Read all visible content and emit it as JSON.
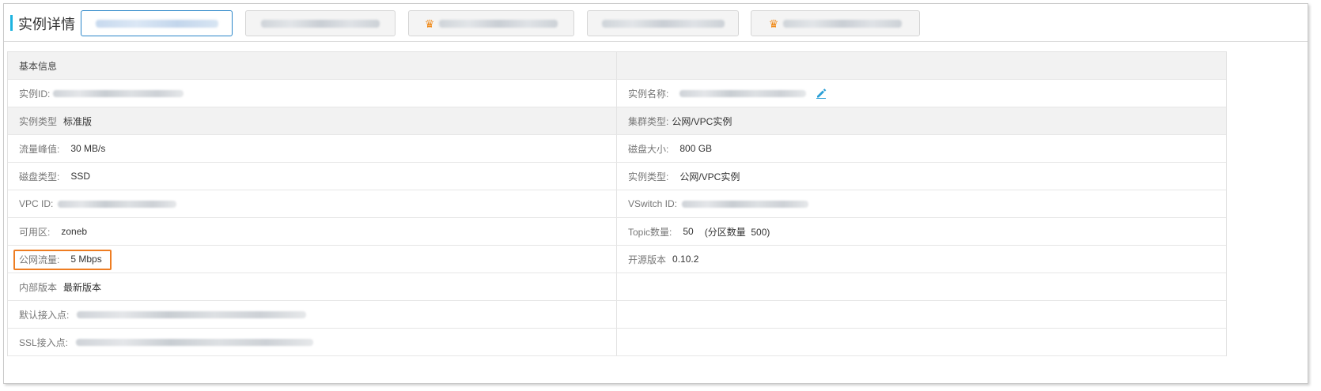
{
  "header": {
    "title": "实例详情",
    "tabs": [
      {
        "label": "",
        "active": true,
        "crown": false
      },
      {
        "label": "",
        "active": false,
        "crown": false
      },
      {
        "label": "",
        "active": false,
        "crown": true
      },
      {
        "label": "",
        "active": false,
        "crown": false
      },
      {
        "label": "",
        "active": false,
        "crown": true
      }
    ]
  },
  "section": {
    "title": "基本信息"
  },
  "rows": {
    "instance_id": {
      "label": "实例ID:"
    },
    "instance_name": {
      "label": "实例名称:"
    },
    "instance_type": {
      "label": "实例类型",
      "value": "标准版"
    },
    "cluster_type": {
      "label": "集群类型:",
      "value": "公网/VPC实例"
    },
    "traffic_peak": {
      "label": "流量峰值:",
      "value": "30 MB/s"
    },
    "disk_size": {
      "label": "磁盘大小:",
      "value": "800 GB"
    },
    "disk_type": {
      "label": "磁盘类型:",
      "value": "SSD"
    },
    "instance_type2": {
      "label": "实例类型:",
      "value": "公网/VPC实例"
    },
    "vpc_id": {
      "label": "VPC ID:"
    },
    "vswitch_id": {
      "label": "VSwitch ID:"
    },
    "zone": {
      "label": "可用区:",
      "value": "zoneb"
    },
    "topic_count": {
      "label": "Topic数量:",
      "value": "50",
      "partition": "(分区数量  500)"
    },
    "public_traffic": {
      "label": "公网流量:",
      "value": "5 Mbps"
    },
    "open_source_version": {
      "label": "开源版本",
      "value": "0.10.2"
    },
    "internal_version": {
      "label": "内部版本",
      "value": "最新版本"
    },
    "default_endpoint": {
      "label": "默认接入点:"
    },
    "ssl_endpoint": {
      "label": "SSL接入点:"
    }
  },
  "colors": {
    "accent": "#1db3e0",
    "highlight": "#ee7d22",
    "edit_icon": "#2b9fd6",
    "crown": "#f08a19"
  },
  "icons": {
    "edit": "pencil-edit-icon",
    "crown": "crown-icon"
  }
}
